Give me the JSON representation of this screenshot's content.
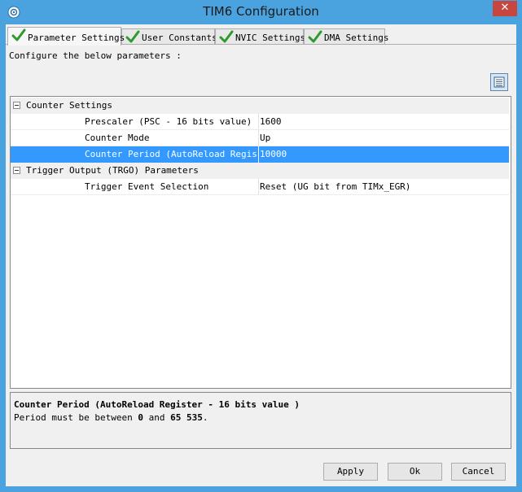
{
  "window": {
    "title": "TIM6 Configuration",
    "close_glyph": "✕",
    "accent": "#4aa3df"
  },
  "tabs": [
    {
      "label": "Parameter Settings",
      "active": true
    },
    {
      "label": "User Constants",
      "active": false
    },
    {
      "label": "NVIC Settings",
      "active": false
    },
    {
      "label": "DMA Settings",
      "active": false
    }
  ],
  "intro_text": "Configure the below parameters :",
  "grid": {
    "categories": [
      {
        "label": "Counter Settings",
        "params": [
          {
            "name": "Prescaler (PSC - 16 bits value)",
            "value": "1600"
          },
          {
            "name": "Counter Mode",
            "value": "Up"
          },
          {
            "name": "Counter Period (AutoReload Regis...",
            "value": "10000",
            "selected": true
          }
        ]
      },
      {
        "label": "Trigger Output (TRGO) Parameters",
        "params": [
          {
            "name": "Trigger Event Selection",
            "value": "Reset (UG bit from TIMx_EGR)"
          }
        ]
      }
    ],
    "selection_color": "#3399ff"
  },
  "description": {
    "heading": "Counter Period (AutoReload Register - 16 bits value )",
    "text_before": "Period must be between ",
    "min": "0",
    "text_mid": " and ",
    "max": "65 535",
    "text_after": "."
  },
  "buttons": {
    "apply": "Apply",
    "ok": "Ok",
    "cancel": "Cancel"
  }
}
